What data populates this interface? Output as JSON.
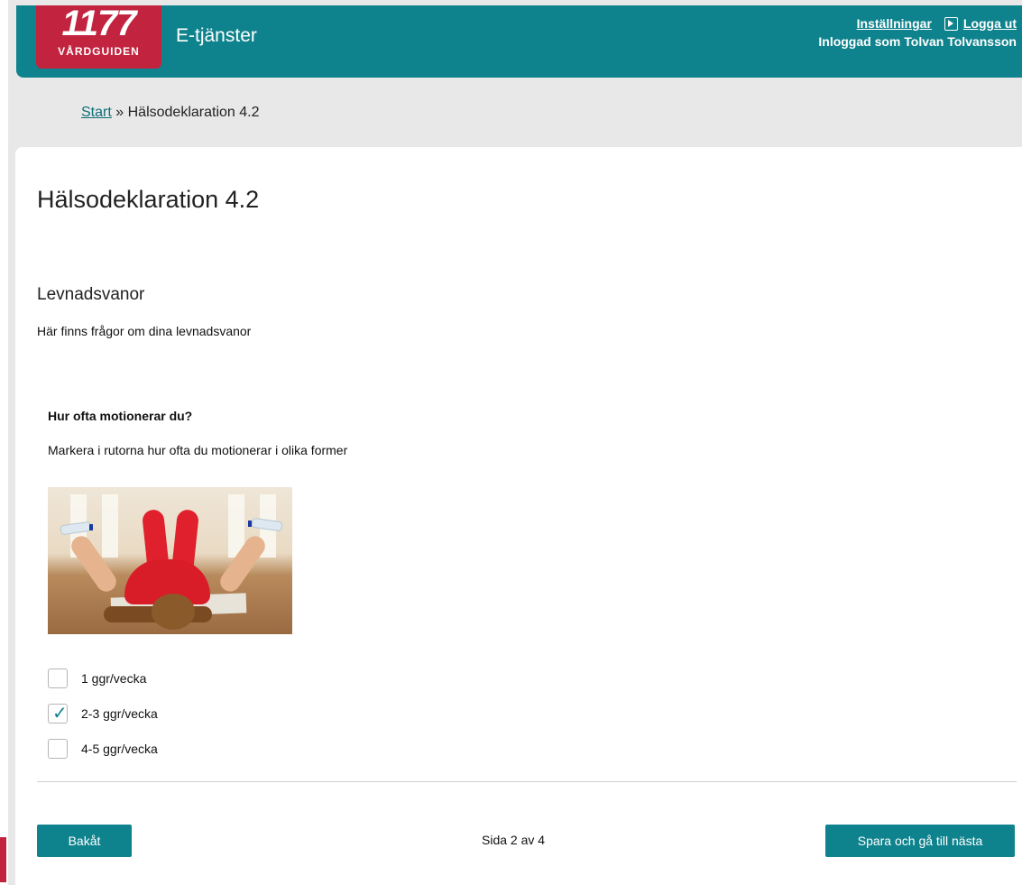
{
  "header": {
    "logo_number": "1177",
    "logo_subtitle": "VÅRDGUIDEN",
    "app_title": "E-tjänster",
    "settings_link": "Inställningar",
    "logout_link": "Logga ut",
    "logged_in_as": "Inloggad som Tolvan Tolvansson"
  },
  "breadcrumb": {
    "home": "Start",
    "separator": "»",
    "current": "Hälsodeklaration 4.2"
  },
  "page": {
    "title": "Hälsodeklaration 4.2",
    "section_title": "Levnadsvanor",
    "section_description": "Här finns frågor om dina levnadsvanor"
  },
  "question": {
    "title": "Hur ofta motionerar du?",
    "help_text": "Markera i rutorna hur ofta du motionerar i olika former",
    "options": [
      {
        "label": "1 ggr/vecka",
        "checked": false
      },
      {
        "label": "2-3 ggr/vecka",
        "checked": true
      },
      {
        "label": "4-5 ggr/vecka",
        "checked": false
      }
    ]
  },
  "footer": {
    "back_label": "Bakåt",
    "page_indicator": "Sida 2 av 4",
    "next_label": "Spara och gå till nästa"
  },
  "colors": {
    "brand_teal": "#0f838d",
    "brand_red": "#c2233f",
    "background": "#e8e8e8"
  }
}
